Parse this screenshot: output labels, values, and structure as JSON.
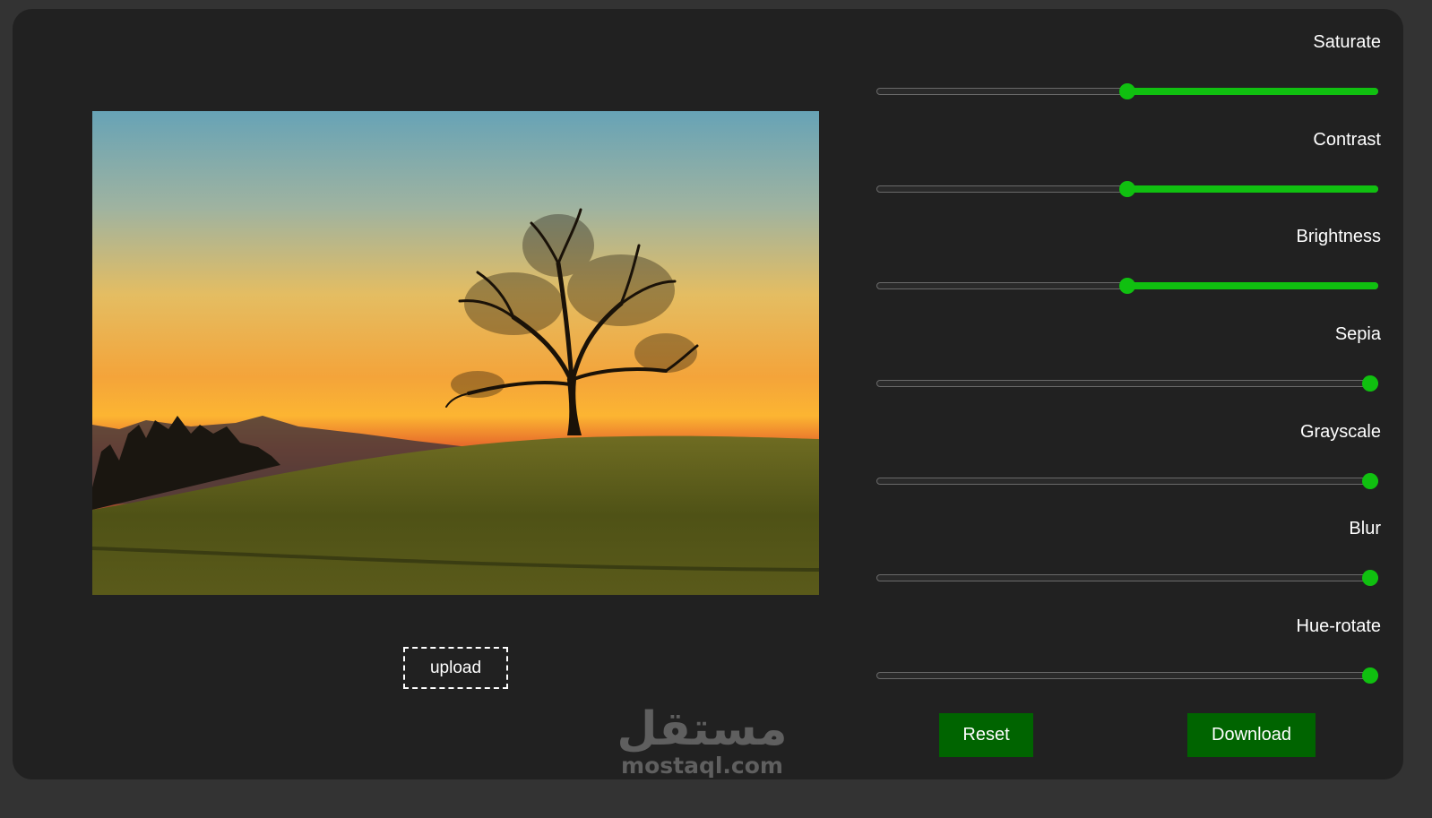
{
  "image": {
    "alt": "sunset landscape with lone tree on a grassy hill"
  },
  "upload": {
    "label": "upload"
  },
  "filters": [
    {
      "id": "saturate",
      "label": "Saturate",
      "value": 0.5
    },
    {
      "id": "contrast",
      "label": "Contrast",
      "value": 0.5
    },
    {
      "id": "brightness",
      "label": "Brightness",
      "value": 0.5
    },
    {
      "id": "sepia",
      "label": "Sepia",
      "value": 1.0
    },
    {
      "id": "grayscale",
      "label": "Grayscale",
      "value": 1.0
    },
    {
      "id": "blur",
      "label": "Blur",
      "value": 1.0
    },
    {
      "id": "hue-rotate",
      "label": "Hue-rotate",
      "value": 1.0
    }
  ],
  "buttons": {
    "reset_label": "Reset",
    "download_label": "Download"
  },
  "watermark": {
    "arabic": "مستقل",
    "latin": "mostaql.com"
  },
  "colors": {
    "accent": "#10c010",
    "button_bg": "#006400",
    "panel_bg": "#212121",
    "page_bg": "#333333"
  },
  "icons": [
    "tree-silhouette-image"
  ]
}
